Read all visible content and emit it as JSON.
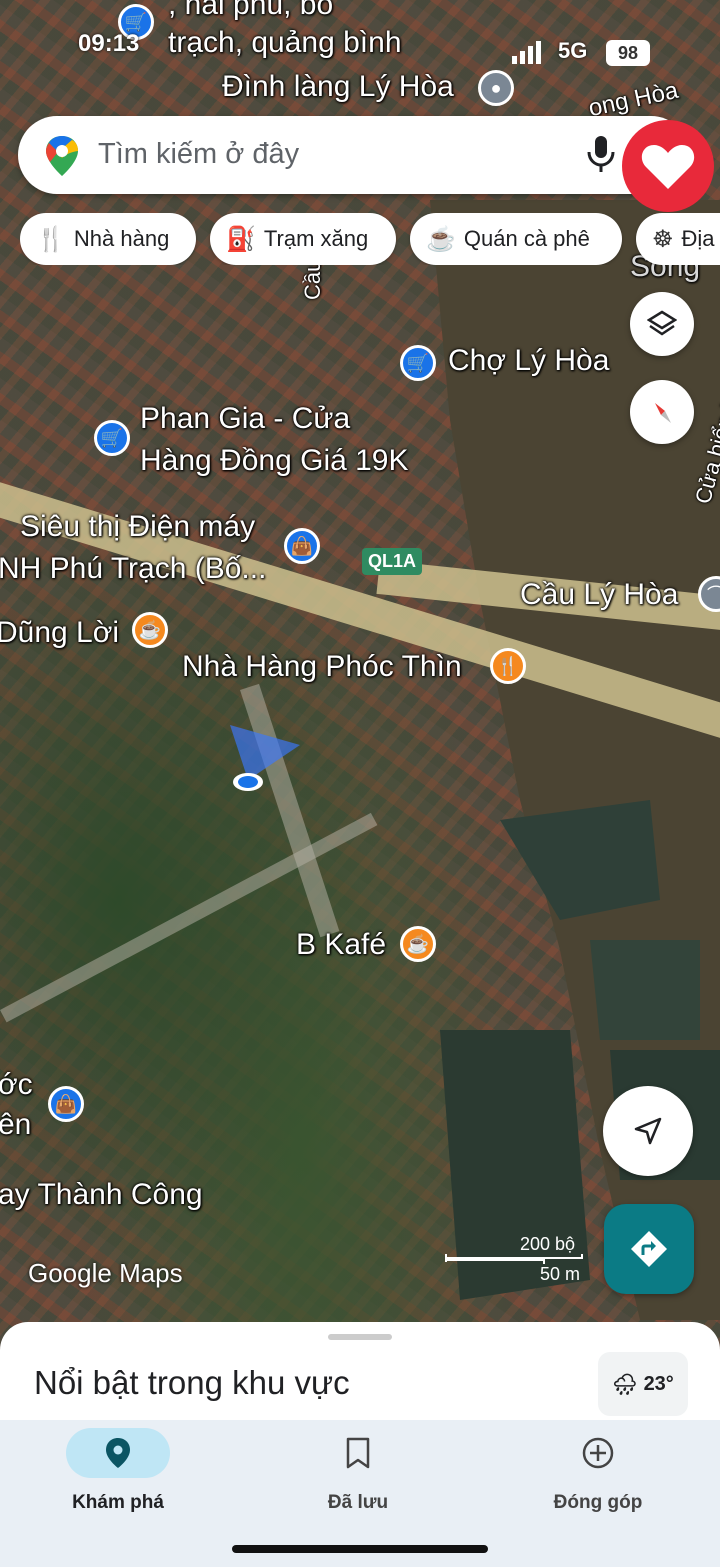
{
  "status_bar": {
    "time": "09:13",
    "network": "5G",
    "battery": "98"
  },
  "search": {
    "placeholder": "Tìm kiếm ở đây"
  },
  "chips": [
    {
      "icon": "fork-knife-icon",
      "label": "Nhà hàng"
    },
    {
      "icon": "gas-station-icon",
      "label": "Trạm xăng"
    },
    {
      "icon": "coffee-cup-icon",
      "label": "Quán cà phê"
    },
    {
      "icon": "ferris-wheel-icon",
      "label": "Địa"
    }
  ],
  "map_labels": {
    "top_address_1": ", hải phú, bố",
    "top_address_2": "trạch, quảng bình",
    "dinh_lang": "Đình làng Lý Hòa",
    "ong_hoa": "ong Hòa",
    "song": "Sông",
    "cau_label": "Cầu C",
    "cho_ly_hoa": "Chợ Lý Hòa",
    "phan_gia_1": "Phan Gia - Cửa",
    "phan_gia_2": "Hàng Đồng Giá 19K",
    "sieu_thi_1": "Siêu thị Điện máy",
    "sieu_thi_2": "NH Phú Trạch (Bố...",
    "highway": "QL1A",
    "cau_ly_hoa": "Cầu Lý Hòa",
    "dung_loi": "Dũng Lời",
    "nha_hang_phoc_thin": "Nhà Hàng Phóc Thìn",
    "b_kafe": "B Kafé",
    "uoc": "ớc",
    "ien": "ên",
    "ay_thanh_cong": "ay Thành Công",
    "cua_bien": "Cửa biển L",
    "scale_1": "200 bộ",
    "scale_2": "50 m",
    "google_maps": "Google Maps"
  },
  "sheet": {
    "title": "Nổi bật trong khu vực",
    "weather_temp": "23°"
  },
  "nav": [
    {
      "icon": "location-pin-icon",
      "label": "Khám phá",
      "active": true
    },
    {
      "icon": "bookmark-icon",
      "label": "Đã lưu",
      "active": false
    },
    {
      "icon": "plus-circle-icon",
      "label": "Đóng góp",
      "active": false
    }
  ],
  "colors": {
    "accent": "#1a73e8",
    "heart": "#e8293a",
    "directions": "#0b7b85",
    "river": "#4b4433"
  }
}
